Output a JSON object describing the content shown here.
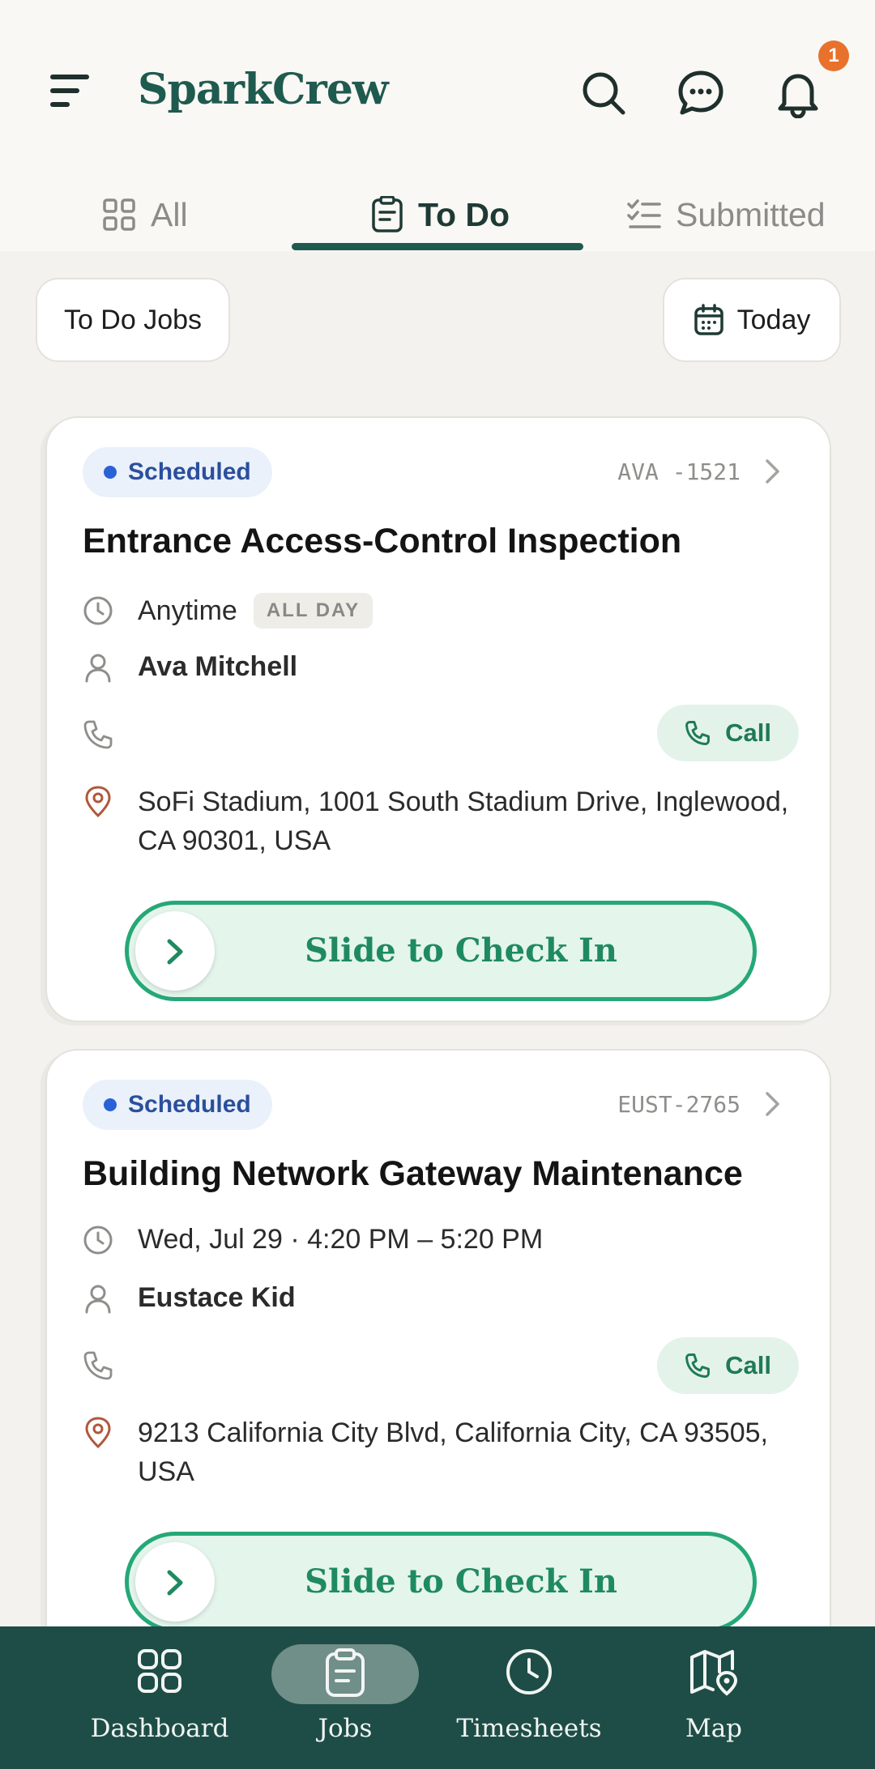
{
  "app": {
    "name": "SparkCrew",
    "notification_count": "1"
  },
  "tabs": [
    {
      "label": "All",
      "icon": "grid-icon",
      "active": false
    },
    {
      "label": "To Do",
      "icon": "clipboard-icon",
      "active": true
    },
    {
      "label": "Submitted",
      "icon": "checklist-icon",
      "active": false
    }
  ],
  "filters": {
    "scope_label": "To Do Jobs",
    "date_label": "Today"
  },
  "jobs": [
    {
      "status": "Scheduled",
      "code": "AVA -1521",
      "title": "Entrance Access-Control Inspection",
      "time": "Anytime",
      "time_badge": "ALL DAY",
      "contact": "Ava Mitchell",
      "call_label": "Call",
      "address": "SoFi Stadium, 1001 South Stadium Drive, Inglewood, CA 90301, USA",
      "slide_label": "Slide to Check In"
    },
    {
      "status": "Scheduled",
      "code": "EUST-2765",
      "title": "Building Network Gateway Maintenance",
      "time": "Wed, Jul 29 · 4:20 PM – 5:20 PM",
      "contact": "Eustace Kid",
      "call_label": "Call",
      "address": "9213 California City Blvd, California City, CA 93505, USA",
      "slide_label": "Slide to Check In"
    }
  ],
  "bottom_nav": [
    {
      "label": "Dashboard",
      "icon": "dashboard-icon",
      "active": false
    },
    {
      "label": "Jobs",
      "icon": "clipboard-icon",
      "active": true
    },
    {
      "label": "Timesheets",
      "icon": "clock-icon",
      "active": false
    },
    {
      "label": "Map",
      "icon": "map-pin-icon",
      "active": false
    }
  ],
  "colors": {
    "brand": "#1f5a4f",
    "accent_green": "#25a877",
    "badge_orange": "#e8712c",
    "status_blue": "#2a62d6",
    "nav_bg": "#1d4d46"
  }
}
